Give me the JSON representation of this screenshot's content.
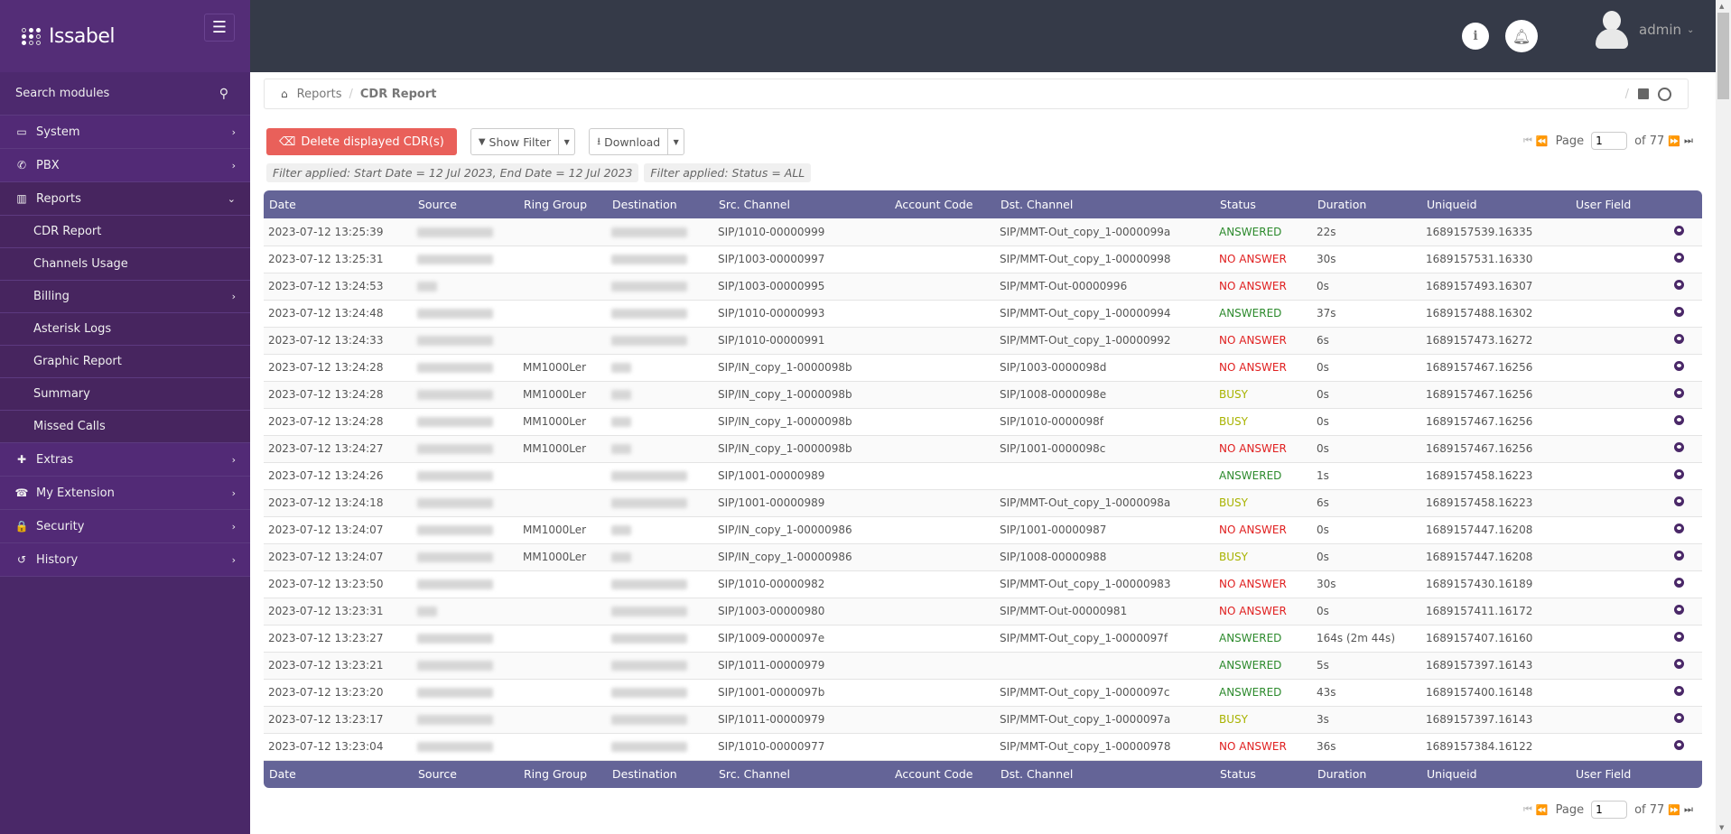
{
  "brand": {
    "name": "Issabel"
  },
  "sidebar": {
    "search_label": "Search modules",
    "items": [
      {
        "label": "System",
        "icon": "laptop-icon",
        "glyph": "▭",
        "has_children": true,
        "open": false
      },
      {
        "label": "PBX",
        "icon": "phone-icon",
        "glyph": "✆",
        "has_children": true,
        "open": false
      },
      {
        "label": "Reports",
        "icon": "bar-chart-icon",
        "glyph": "▥",
        "has_children": true,
        "open": true
      },
      {
        "label": "Extras",
        "icon": "plus-icon",
        "glyph": "✚",
        "has_children": true,
        "open": false
      },
      {
        "label": "My Extension",
        "icon": "fax-icon",
        "glyph": "☎",
        "has_children": true,
        "open": false
      },
      {
        "label": "Security",
        "icon": "lock-icon",
        "glyph": "🔒",
        "has_children": true,
        "open": false
      },
      {
        "label": "History",
        "icon": "history-icon",
        "glyph": "↺",
        "has_children": true,
        "open": false
      }
    ],
    "report_subitems": [
      {
        "label": "CDR Report",
        "has_children": false
      },
      {
        "label": "Channels Usage",
        "has_children": false
      },
      {
        "label": "Billing",
        "has_children": true
      },
      {
        "label": "Asterisk Logs",
        "has_children": false
      },
      {
        "label": "Graphic Report",
        "has_children": false
      },
      {
        "label": "Summary",
        "has_children": false
      },
      {
        "label": "Missed Calls",
        "has_children": false
      }
    ]
  },
  "topbar": {
    "user": "admin"
  },
  "breadcrumb": {
    "parent": "Reports",
    "current": "CDR Report",
    "separator": "/"
  },
  "toolbar": {
    "delete_label": "Delete displayed CDR(s)",
    "filter_label": "Show Filter",
    "download_label": "Download"
  },
  "filters": [
    "Filter applied: Start Date = 12 Jul 2023, End Date = 12 Jul 2023",
    "Filter applied: Status = ALL"
  ],
  "pager": {
    "label": "Page",
    "current": "1",
    "of_label": "of 77"
  },
  "table": {
    "columns": [
      "Date",
      "Source",
      "Ring Group",
      "Destination",
      "Src. Channel",
      "Account Code",
      "Dst. Channel",
      "Status",
      "Duration",
      "Uniqueid",
      "User Field"
    ],
    "rows": [
      {
        "date": "2023-07-12 13:25:39",
        "src": "long",
        "ring": "",
        "dst": "long",
        "src_channel": "SIP/1010-00000999",
        "account": "",
        "dst_channel": "SIP/MMT-Out_copy_1-0000099a",
        "status": "ANSWERED",
        "duration": "22s",
        "uniqueid": "1689157539.16335",
        "userfield": ""
      },
      {
        "date": "2023-07-12 13:25:31",
        "src": "long",
        "ring": "",
        "dst": "long",
        "src_channel": "SIP/1003-00000997",
        "account": "",
        "dst_channel": "SIP/MMT-Out_copy_1-00000998",
        "status": "NO ANSWER",
        "duration": "30s",
        "uniqueid": "1689157531.16330",
        "userfield": ""
      },
      {
        "date": "2023-07-12 13:24:53",
        "src": "short",
        "ring": "",
        "dst": "long",
        "src_channel": "SIP/1003-00000995",
        "account": "",
        "dst_channel": "SIP/MMT-Out-00000996",
        "status": "NO ANSWER",
        "duration": "0s",
        "uniqueid": "1689157493.16307",
        "userfield": ""
      },
      {
        "date": "2023-07-12 13:24:48",
        "src": "long",
        "ring": "",
        "dst": "long",
        "src_channel": "SIP/1010-00000993",
        "account": "",
        "dst_channel": "SIP/MMT-Out_copy_1-00000994",
        "status": "ANSWERED",
        "duration": "37s",
        "uniqueid": "1689157488.16302",
        "userfield": ""
      },
      {
        "date": "2023-07-12 13:24:33",
        "src": "long",
        "ring": "",
        "dst": "long",
        "src_channel": "SIP/1010-00000991",
        "account": "",
        "dst_channel": "SIP/MMT-Out_copy_1-00000992",
        "status": "NO ANSWER",
        "duration": "6s",
        "uniqueid": "1689157473.16272",
        "userfield": ""
      },
      {
        "date": "2023-07-12 13:24:28",
        "src": "long",
        "ring": "MM1000Ler",
        "dst": "short",
        "src_channel": "SIP/IN_copy_1-0000098b",
        "account": "",
        "dst_channel": "SIP/1003-0000098d",
        "status": "NO ANSWER",
        "duration": "0s",
        "uniqueid": "1689157467.16256",
        "userfield": ""
      },
      {
        "date": "2023-07-12 13:24:28",
        "src": "long",
        "ring": "MM1000Ler",
        "dst": "short",
        "src_channel": "SIP/IN_copy_1-0000098b",
        "account": "",
        "dst_channel": "SIP/1008-0000098e",
        "status": "BUSY",
        "duration": "0s",
        "uniqueid": "1689157467.16256",
        "userfield": ""
      },
      {
        "date": "2023-07-12 13:24:28",
        "src": "long",
        "ring": "MM1000Ler",
        "dst": "short",
        "src_channel": "SIP/IN_copy_1-0000098b",
        "account": "",
        "dst_channel": "SIP/1010-0000098f",
        "status": "BUSY",
        "duration": "0s",
        "uniqueid": "1689157467.16256",
        "userfield": ""
      },
      {
        "date": "2023-07-12 13:24:27",
        "src": "long",
        "ring": "MM1000Ler",
        "dst": "short",
        "src_channel": "SIP/IN_copy_1-0000098b",
        "account": "",
        "dst_channel": "SIP/1001-0000098c",
        "status": "NO ANSWER",
        "duration": "0s",
        "uniqueid": "1689157467.16256",
        "userfield": ""
      },
      {
        "date": "2023-07-12 13:24:26",
        "src": "long",
        "ring": "",
        "dst": "long",
        "src_channel": "SIP/1001-00000989",
        "account": "",
        "dst_channel": "",
        "status": "ANSWERED",
        "duration": "1s",
        "uniqueid": "1689157458.16223",
        "userfield": ""
      },
      {
        "date": "2023-07-12 13:24:18",
        "src": "long",
        "ring": "",
        "dst": "long",
        "src_channel": "SIP/1001-00000989",
        "account": "",
        "dst_channel": "SIP/MMT-Out_copy_1-0000098a",
        "status": "BUSY",
        "duration": "6s",
        "uniqueid": "1689157458.16223",
        "userfield": ""
      },
      {
        "date": "2023-07-12 13:24:07",
        "src": "long",
        "ring": "MM1000Ler",
        "dst": "short",
        "src_channel": "SIP/IN_copy_1-00000986",
        "account": "",
        "dst_channel": "SIP/1001-00000987",
        "status": "NO ANSWER",
        "duration": "0s",
        "uniqueid": "1689157447.16208",
        "userfield": ""
      },
      {
        "date": "2023-07-12 13:24:07",
        "src": "long",
        "ring": "MM1000Ler",
        "dst": "short",
        "src_channel": "SIP/IN_copy_1-00000986",
        "account": "",
        "dst_channel": "SIP/1008-00000988",
        "status": "BUSY",
        "duration": "0s",
        "uniqueid": "1689157447.16208",
        "userfield": ""
      },
      {
        "date": "2023-07-12 13:23:50",
        "src": "long",
        "ring": "",
        "dst": "long",
        "src_channel": "SIP/1010-00000982",
        "account": "",
        "dst_channel": "SIP/MMT-Out_copy_1-00000983",
        "status": "NO ANSWER",
        "duration": "30s",
        "uniqueid": "1689157430.16189",
        "userfield": ""
      },
      {
        "date": "2023-07-12 13:23:31",
        "src": "short",
        "ring": "",
        "dst": "long",
        "src_channel": "SIP/1003-00000980",
        "account": "",
        "dst_channel": "SIP/MMT-Out-00000981",
        "status": "NO ANSWER",
        "duration": "0s",
        "uniqueid": "1689157411.16172",
        "userfield": ""
      },
      {
        "date": "2023-07-12 13:23:27",
        "src": "long",
        "ring": "",
        "dst": "long",
        "src_channel": "SIP/1009-0000097e",
        "account": "",
        "dst_channel": "SIP/MMT-Out_copy_1-0000097f",
        "status": "ANSWERED",
        "duration": "164s (2m 44s)",
        "uniqueid": "1689157407.16160",
        "userfield": ""
      },
      {
        "date": "2023-07-12 13:23:21",
        "src": "long",
        "ring": "",
        "dst": "long",
        "src_channel": "SIP/1011-00000979",
        "account": "",
        "dst_channel": "",
        "status": "ANSWERED",
        "duration": "5s",
        "uniqueid": "1689157397.16143",
        "userfield": ""
      },
      {
        "date": "2023-07-12 13:23:20",
        "src": "long",
        "ring": "",
        "dst": "long",
        "src_channel": "SIP/1001-0000097b",
        "account": "",
        "dst_channel": "SIP/MMT-Out_copy_1-0000097c",
        "status": "ANSWERED",
        "duration": "43s",
        "uniqueid": "1689157400.16148",
        "userfield": ""
      },
      {
        "date": "2023-07-12 13:23:17",
        "src": "long",
        "ring": "",
        "dst": "long",
        "src_channel": "SIP/1011-00000979",
        "account": "",
        "dst_channel": "SIP/MMT-Out_copy_1-0000097a",
        "status": "BUSY",
        "duration": "3s",
        "uniqueid": "1689157397.16143",
        "userfield": ""
      },
      {
        "date": "2023-07-12 13:23:04",
        "src": "long",
        "ring": "",
        "dst": "long",
        "src_channel": "SIP/1010-00000977",
        "account": "",
        "dst_channel": "SIP/MMT-Out_copy_1-00000978",
        "status": "NO ANSWER",
        "duration": "36s",
        "uniqueid": "1689157384.16122",
        "userfield": ""
      }
    ]
  },
  "colors": {
    "sidebar": "#4a2868",
    "topbar": "#353a48",
    "table_header": "#646497",
    "danger": "#e9605a",
    "answered": "#2c8a2c",
    "no_answer": "#e02020",
    "busy": "#a8b300"
  }
}
